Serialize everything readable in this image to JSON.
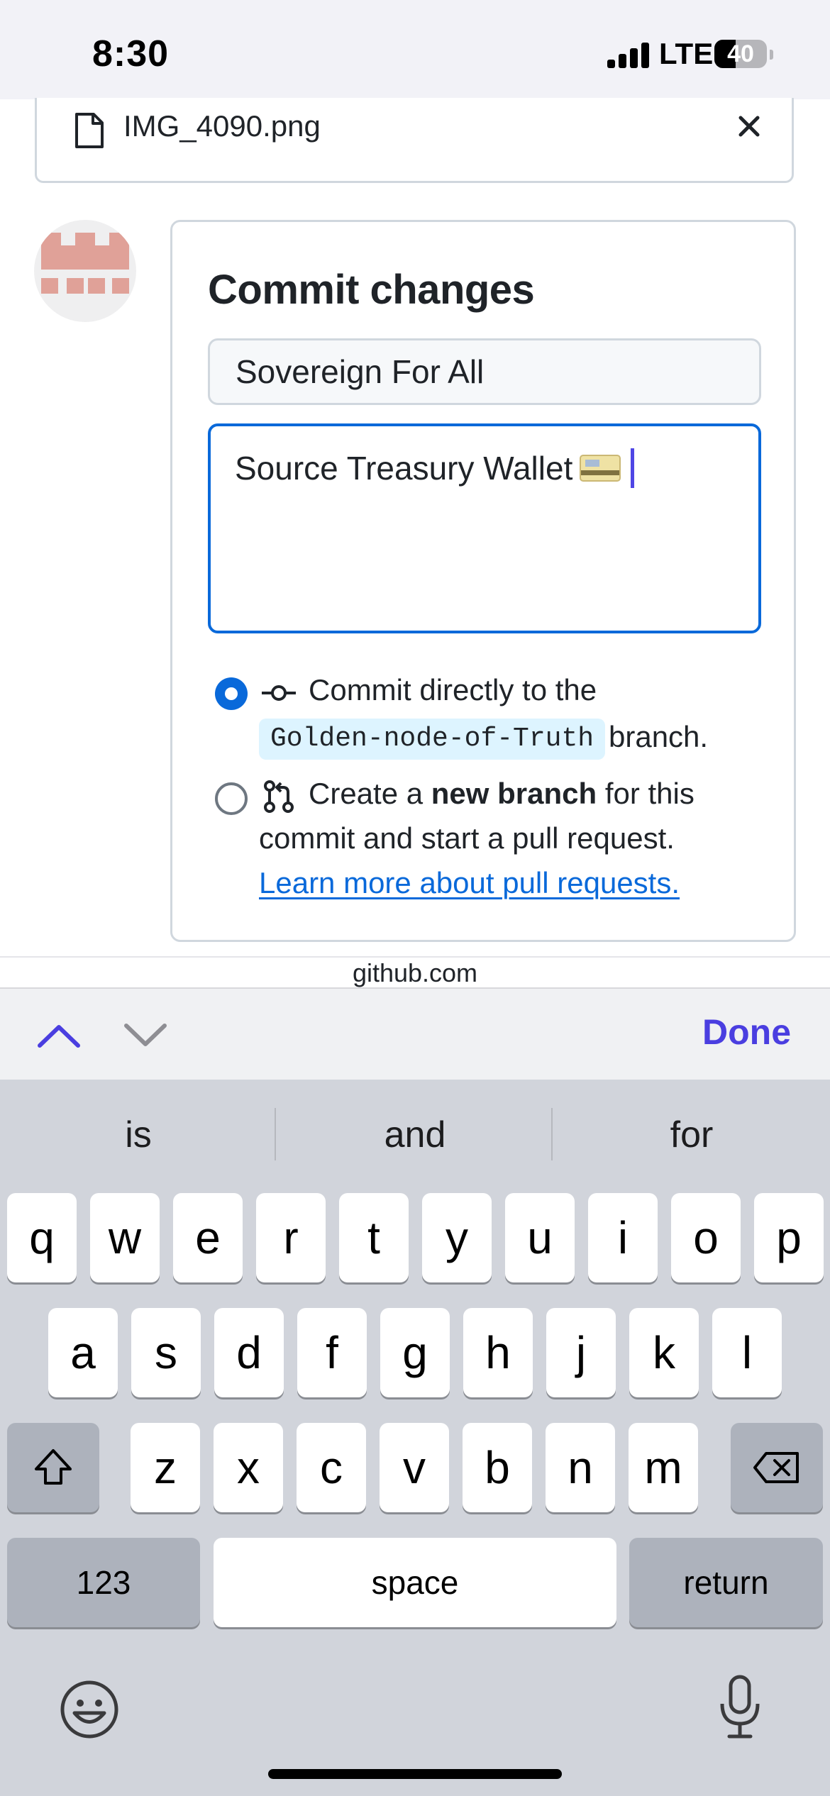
{
  "status_bar": {
    "time": "8:30",
    "network": "LTE",
    "battery": "40",
    "battery_level": 0.4
  },
  "attachment": {
    "file_name": "IMG_4090.png",
    "icon": "file-icon",
    "close_icon": "close-icon"
  },
  "avatar": {
    "icon": "identicon-avatar"
  },
  "commit": {
    "title": "Commit changes",
    "summary_value": "Sovereign For All",
    "description_value": "Source Treasury Wallet",
    "description_emoji": "credit-card-emoji",
    "option_direct": {
      "prefix": "Commit directly to the",
      "branch": "Golden-node-of-Truth",
      "suffix": "branch.",
      "selected": true
    },
    "option_new_branch": {
      "pre": "Create a ",
      "bold": "new branch",
      "post": " for this",
      "line2": "commit and start a pull request.",
      "selected": false
    },
    "learn_link": "Learn more about pull requests."
  },
  "browser": {
    "url": "github.com"
  },
  "accessory": {
    "done_label": "Done",
    "accent": "#4a3ee0"
  },
  "keyboard": {
    "suggestions": [
      "is",
      "and",
      "for"
    ],
    "row1": [
      "q",
      "w",
      "e",
      "r",
      "t",
      "y",
      "u",
      "i",
      "o",
      "p"
    ],
    "row2": [
      "a",
      "s",
      "d",
      "f",
      "g",
      "h",
      "j",
      "k",
      "l"
    ],
    "row3": [
      "z",
      "x",
      "c",
      "v",
      "b",
      "n",
      "m"
    ],
    "numbers_label": "123",
    "space_label": "space",
    "return_label": "return"
  },
  "colors": {
    "link": "#0969da",
    "focus_border": "#0969da",
    "branch_badge_bg": "#ddf4ff",
    "keyboard_bg": "#d1d4db"
  }
}
